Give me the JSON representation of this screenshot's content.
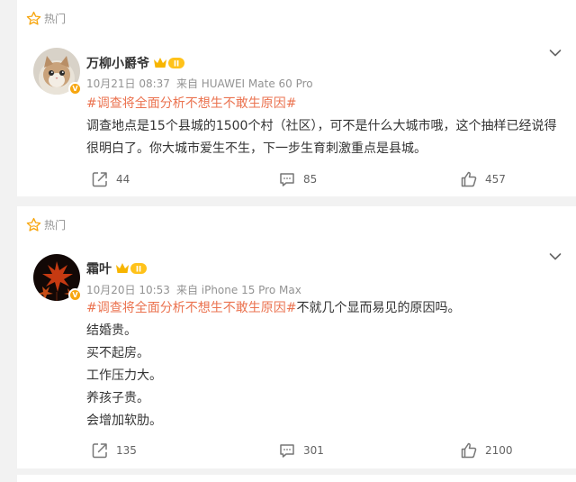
{
  "posts": [
    {
      "hot_label": "热门",
      "author": "万柳小爵爷",
      "member_level": "II",
      "date": "10月21日 08:37",
      "source": "来自 HUAWEI Mate 60 Pro",
      "verify_mark": "V",
      "tag": "#调查将全面分析不想生不敢生原因#",
      "lines": [
        "调查地点是15个县城的1500个村（社区），可不是什么大城市哦，这个抽样已经说得很明白了。你大城市爱生不生，下一步生育刺激重点是县城。"
      ],
      "reposts": "44",
      "comments": "85",
      "likes": "457"
    },
    {
      "hot_label": "热门",
      "author": "霜叶",
      "member_level": "II",
      "date": "10月20日 10:53",
      "source": "来自 iPhone 15 Pro Max",
      "verify_mark": "V",
      "tag": "#调查将全面分析不想生不敢生原因#",
      "tag_suffix": "不就几个显而易见的原因吗。",
      "lines": [
        "结婚贵。",
        "买不起房。",
        "工作压力大。",
        "养孩子贵。",
        "会增加软肋。"
      ],
      "reposts": "135",
      "comments": "301",
      "likes": "2100"
    }
  ],
  "icons": {
    "hot": "star-icon",
    "more": "chevron-down-icon",
    "repost": "share-icon",
    "comment": "comment-icon",
    "like": "thumbs-up-icon"
  },
  "colors": {
    "tag": "#eb7350",
    "hot_star": "#f7a60f",
    "badge": "#f7a60f",
    "text": "#333333",
    "muted": "#939393"
  }
}
